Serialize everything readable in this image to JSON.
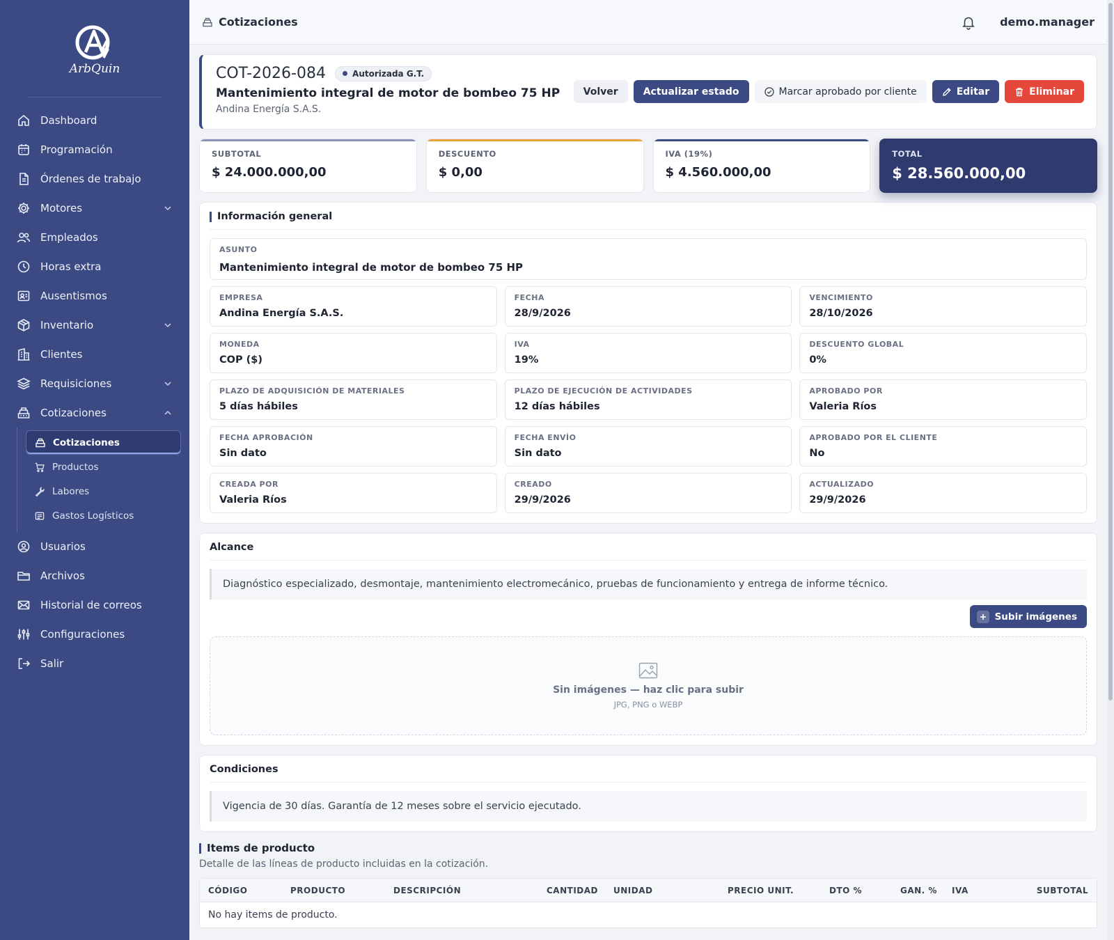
{
  "brand": {
    "name": "ArbQuin"
  },
  "sidebar": {
    "items": [
      {
        "label": "Dashboard",
        "icon": "home-icon"
      },
      {
        "label": "Programación",
        "icon": "calendar-icon"
      },
      {
        "label": "Órdenes de trabajo",
        "icon": "document-icon"
      },
      {
        "label": "Motores",
        "icon": "gear-icon"
      },
      {
        "label": "Empleados",
        "icon": "users-icon"
      },
      {
        "label": "Horas extra",
        "icon": "clock-icon"
      },
      {
        "label": "Ausentismos",
        "icon": "id-card-icon"
      },
      {
        "label": "Inventario",
        "icon": "box-icon"
      },
      {
        "label": "Clientes",
        "icon": "building-icon"
      },
      {
        "label": "Requisiciones",
        "icon": "layers-icon"
      },
      {
        "label": "Cotizaciones",
        "icon": "register-icon"
      },
      {
        "label": "Usuarios",
        "icon": "user-circle-icon"
      },
      {
        "label": "Archivos",
        "icon": "folder-icon"
      },
      {
        "label": "Historial de correos",
        "icon": "mail-icon"
      },
      {
        "label": "Configuraciones",
        "icon": "sliders-icon"
      },
      {
        "label": "Salir",
        "icon": "logout-icon"
      }
    ],
    "sub_items": [
      {
        "label": "Cotizaciones",
        "icon": "register-icon"
      },
      {
        "label": "Productos",
        "icon": "cart-icon"
      },
      {
        "label": "Labores",
        "icon": "wrench-icon"
      },
      {
        "label": "Gastos Logísticos",
        "icon": "receipt-icon"
      }
    ]
  },
  "topbar": {
    "title": "Cotizaciones",
    "user": "demo.manager"
  },
  "header": {
    "quote_id": "COT-2026-084",
    "status": "Autorizada G.T.",
    "title": "Mantenimiento integral de motor de bombeo 75 HP",
    "company": "Andina Energía S.A.S.",
    "actions": {
      "back": "Volver",
      "update_status": "Actualizar estado",
      "mark_approved": "Marcar aprobado por cliente",
      "edit": "Editar",
      "delete": "Eliminar"
    }
  },
  "totals": [
    {
      "label": "SUBTOTAL",
      "value": "$ 24.000.000,00",
      "accent": "#8893b8"
    },
    {
      "label": "DESCUENTO",
      "value": "$ 0,00",
      "accent": "#e9a23b"
    },
    {
      "label": "IVA (19%)",
      "value": "$ 4.560.000,00",
      "accent": "#3b4a82"
    },
    {
      "label": "TOTAL",
      "value": "$ 28.560.000,00",
      "accent": "#2f3b6e"
    }
  ],
  "general": {
    "title": "Información general",
    "asunto": {
      "label": "ASUNTO",
      "value": "Mantenimiento integral de motor de bombeo 75 HP"
    },
    "fields": [
      {
        "label": "EMPRESA",
        "value": "Andina Energía S.A.S."
      },
      {
        "label": "FECHA",
        "value": "28/9/2026"
      },
      {
        "label": "VENCIMIENTO",
        "value": "28/10/2026"
      },
      {
        "label": "MONEDA",
        "value": "COP ($)"
      },
      {
        "label": "IVA",
        "value": "19%"
      },
      {
        "label": "DESCUENTO GLOBAL",
        "value": "0%"
      },
      {
        "label": "PLAZO DE ADQUISICIÓN DE MATERIALES",
        "value": "5 días hábiles"
      },
      {
        "label": "PLAZO DE EJECUCIÓN DE ACTIVIDADES",
        "value": "12 días hábiles"
      },
      {
        "label": "APROBADO POR",
        "value": "Valeria Ríos"
      },
      {
        "label": "FECHA APROBACIÓN",
        "value": "Sin dato"
      },
      {
        "label": "FECHA ENVÍO",
        "value": "Sin dato"
      },
      {
        "label": "APROBADO POR EL CLIENTE",
        "value": "No"
      },
      {
        "label": "CREADA POR",
        "value": "Valeria Ríos"
      },
      {
        "label": "CREADO",
        "value": "29/9/2026"
      },
      {
        "label": "ACTUALIZADO",
        "value": "29/9/2026"
      }
    ]
  },
  "alcance": {
    "title": "Alcance",
    "text": "Diagnóstico especializado, desmontaje, mantenimiento electromecánico, pruebas de funcionamiento y entrega de informe técnico.",
    "upload_button": "Subir imágenes",
    "empty_title": "Sin imágenes — haz clic para subir",
    "empty_hint": "JPG, PNG o WEBP"
  },
  "condiciones": {
    "title": "Condiciones",
    "text": "Vigencia de 30 días. Garantía de 12 meses sobre el servicio ejecutado."
  },
  "items": {
    "title": "Items de producto",
    "description": "Detalle de las líneas de producto incluidas en la cotización.",
    "columns": [
      "CÓDIGO",
      "PRODUCTO",
      "DESCRIPCIÓN",
      "CANTIDAD",
      "UNIDAD",
      "PRECIO UNIT.",
      "DTO %",
      "GAN. %",
      "IVA",
      "SUBTOTAL"
    ],
    "empty": "No hay items de producto."
  },
  "colors": {
    "sidebar": "#3b4a82",
    "primary": "#3b4a82",
    "danger": "#e5483a",
    "accent_orange": "#e9a23b"
  }
}
